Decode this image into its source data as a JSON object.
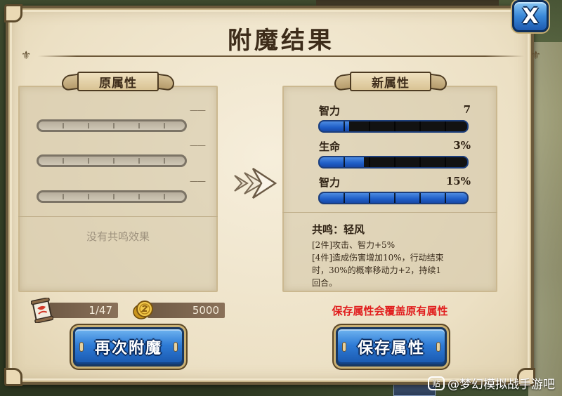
{
  "dialog": {
    "title": "附魔结果",
    "close_label": "X"
  },
  "original_panel": {
    "header": "原属性",
    "rows": [
      {
        "value": "——"
      },
      {
        "value": "——"
      },
      {
        "value": "——"
      }
    ],
    "resonance_text": "没有共鸣效果"
  },
  "new_panel": {
    "header": "新属性",
    "stats": [
      {
        "label": "智力",
        "value": "7",
        "fill_fraction": 0.2
      },
      {
        "label": "生命",
        "value": "3%",
        "fill_fraction": 0.3
      },
      {
        "label": "智力",
        "value": "15%",
        "fill_fraction": 1.0
      }
    ],
    "resonance": {
      "title": "共鸣：轻风",
      "lines": [
        "[2件]攻击、智力+5%",
        "[4件]造成伤害增加10%，行动结束",
        "时，30%的概率移动力+2，持续1",
        "回合。"
      ]
    }
  },
  "resources": {
    "scroll_count": "1/47",
    "gold_amount": "5000"
  },
  "warning_text": "保存属性会覆盖原有属性",
  "buttons": {
    "reenchant_label": "再次附魔",
    "save_label": "保存属性"
  },
  "watermark": {
    "icon_text": "贴",
    "text": "@梦幻模拟战手游吧"
  },
  "colors": {
    "parchment": "#ece0c4",
    "bar_fill": "#1f5ec7",
    "warning": "#e11e1e",
    "button_blue": "#2e7bd6"
  }
}
